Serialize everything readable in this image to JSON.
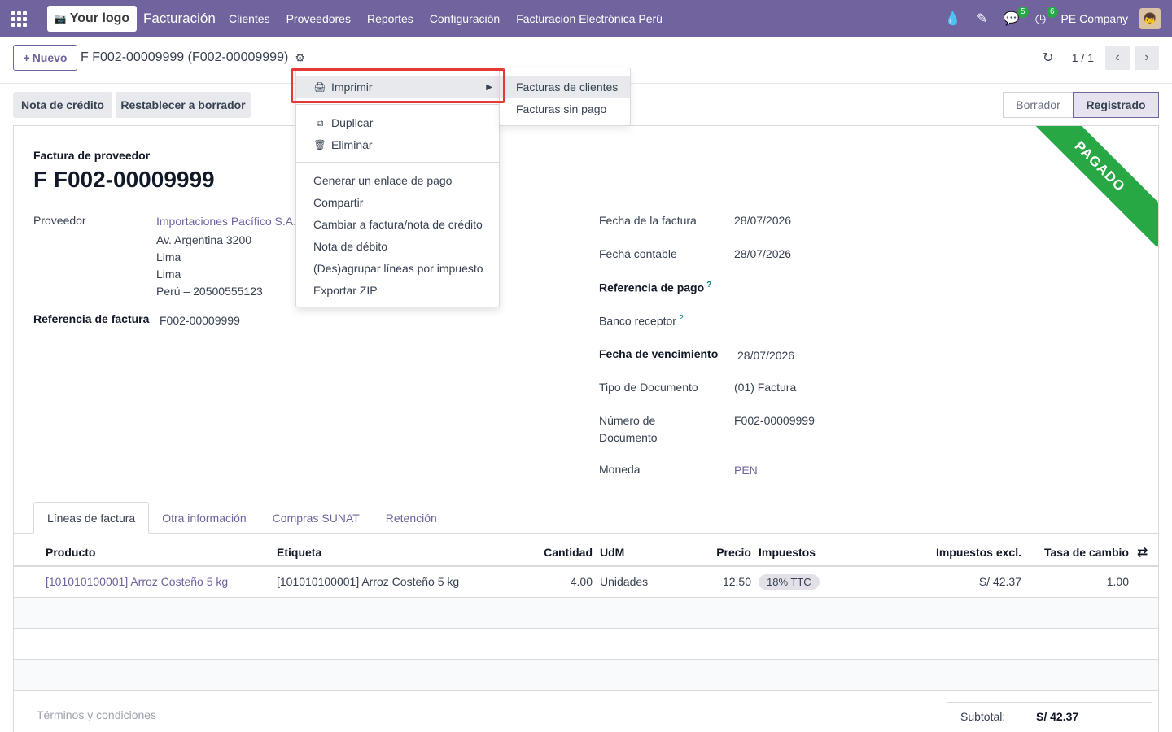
{
  "navbar": {
    "logo_text": "Your logo",
    "brand": "Facturación",
    "menu": [
      "Clientes",
      "Proveedores",
      "Reportes",
      "Configuración",
      "Facturación Electrónica Perú"
    ],
    "chat_badge": "5",
    "activity_badge": "6",
    "company": "PE Company"
  },
  "control": {
    "new_label": "Nuevo",
    "breadcrumb": "F F002-00009999 (F002-00009999)",
    "pager": "1 / 1"
  },
  "actions": {
    "credit_note": "Nota de crédito",
    "reset_draft": "Restablecer a borrador"
  },
  "status": {
    "draft": "Borrador",
    "posted": "Registrado"
  },
  "form": {
    "ribbon": "PAGADO",
    "doc_type": "Factura de proveedor",
    "title": "F F002-00009999",
    "vendor_label": "Proveedor",
    "vendor_name": "Importaciones Pacífico S.A.C",
    "vendor_street": "Av. Argentina 3200",
    "vendor_city": "Lima",
    "vendor_state": "Lima",
    "vendor_country": "Perú – 20500555123",
    "ref_label": "Referencia de factura",
    "ref_value": "F002-00009999",
    "invoice_date_label": "Fecha de la factura",
    "invoice_date": "28/07/2026",
    "accounting_date_label": "Fecha contable",
    "accounting_date": "28/07/2026",
    "payment_ref_label": "Referencia de pago",
    "bank_label": "Banco receptor",
    "due_date_label": "Fecha de vencimiento",
    "due_date": "28/07/2026",
    "doc_kind_label": "Tipo de Documento",
    "doc_kind": "(01) Factura",
    "doc_number_label_1": "Número de",
    "doc_number_label_2": "Documento",
    "doc_number": "F002-00009999",
    "currency_label": "Moneda",
    "currency": "PEN"
  },
  "tabs": [
    "Líneas de factura",
    "Otra información",
    "Compras SUNAT",
    "Retención"
  ],
  "table": {
    "headers": {
      "product": "Producto",
      "label": "Etiqueta",
      "qty": "Cantidad",
      "uom": "UdM",
      "price": "Precio",
      "taxes": "Impuestos",
      "subtotal": "Impuestos excl.",
      "rate": "Tasa de cambio"
    },
    "rows": [
      {
        "product": "[101010100001] Arroz Costeño 5 kg",
        "label": "[101010100001] Arroz Costeño 5 kg",
        "qty": "4.00",
        "uom": "Unidades",
        "price": "12.50",
        "tax": "18% TTC",
        "subtotal": "S/ 42.37",
        "rate": "1.00"
      }
    ]
  },
  "footer": {
    "terms": "Términos y condiciones",
    "subtotal_label": "Subtotal:",
    "subtotal_value": "S/ 42.37"
  },
  "dropdown": {
    "print": "Imprimir",
    "duplicate": "Duplicar",
    "delete": "Eliminar",
    "payment_link": "Generar un enlace de pago",
    "share": "Compartir",
    "switch": "Cambiar a factura/nota de crédito",
    "debit_note": "Nota de débito",
    "group_tax": "(Des)agrupar líneas por impuesto",
    "export_zip": "Exportar ZIP"
  },
  "submenu": {
    "customer_invoices": "Facturas de clientes",
    "unpaid_invoices": "Facturas sin pago"
  },
  "colors": {
    "primary": "#71639e",
    "paid_ribbon": "#28a745",
    "highlight": "#e53935"
  }
}
